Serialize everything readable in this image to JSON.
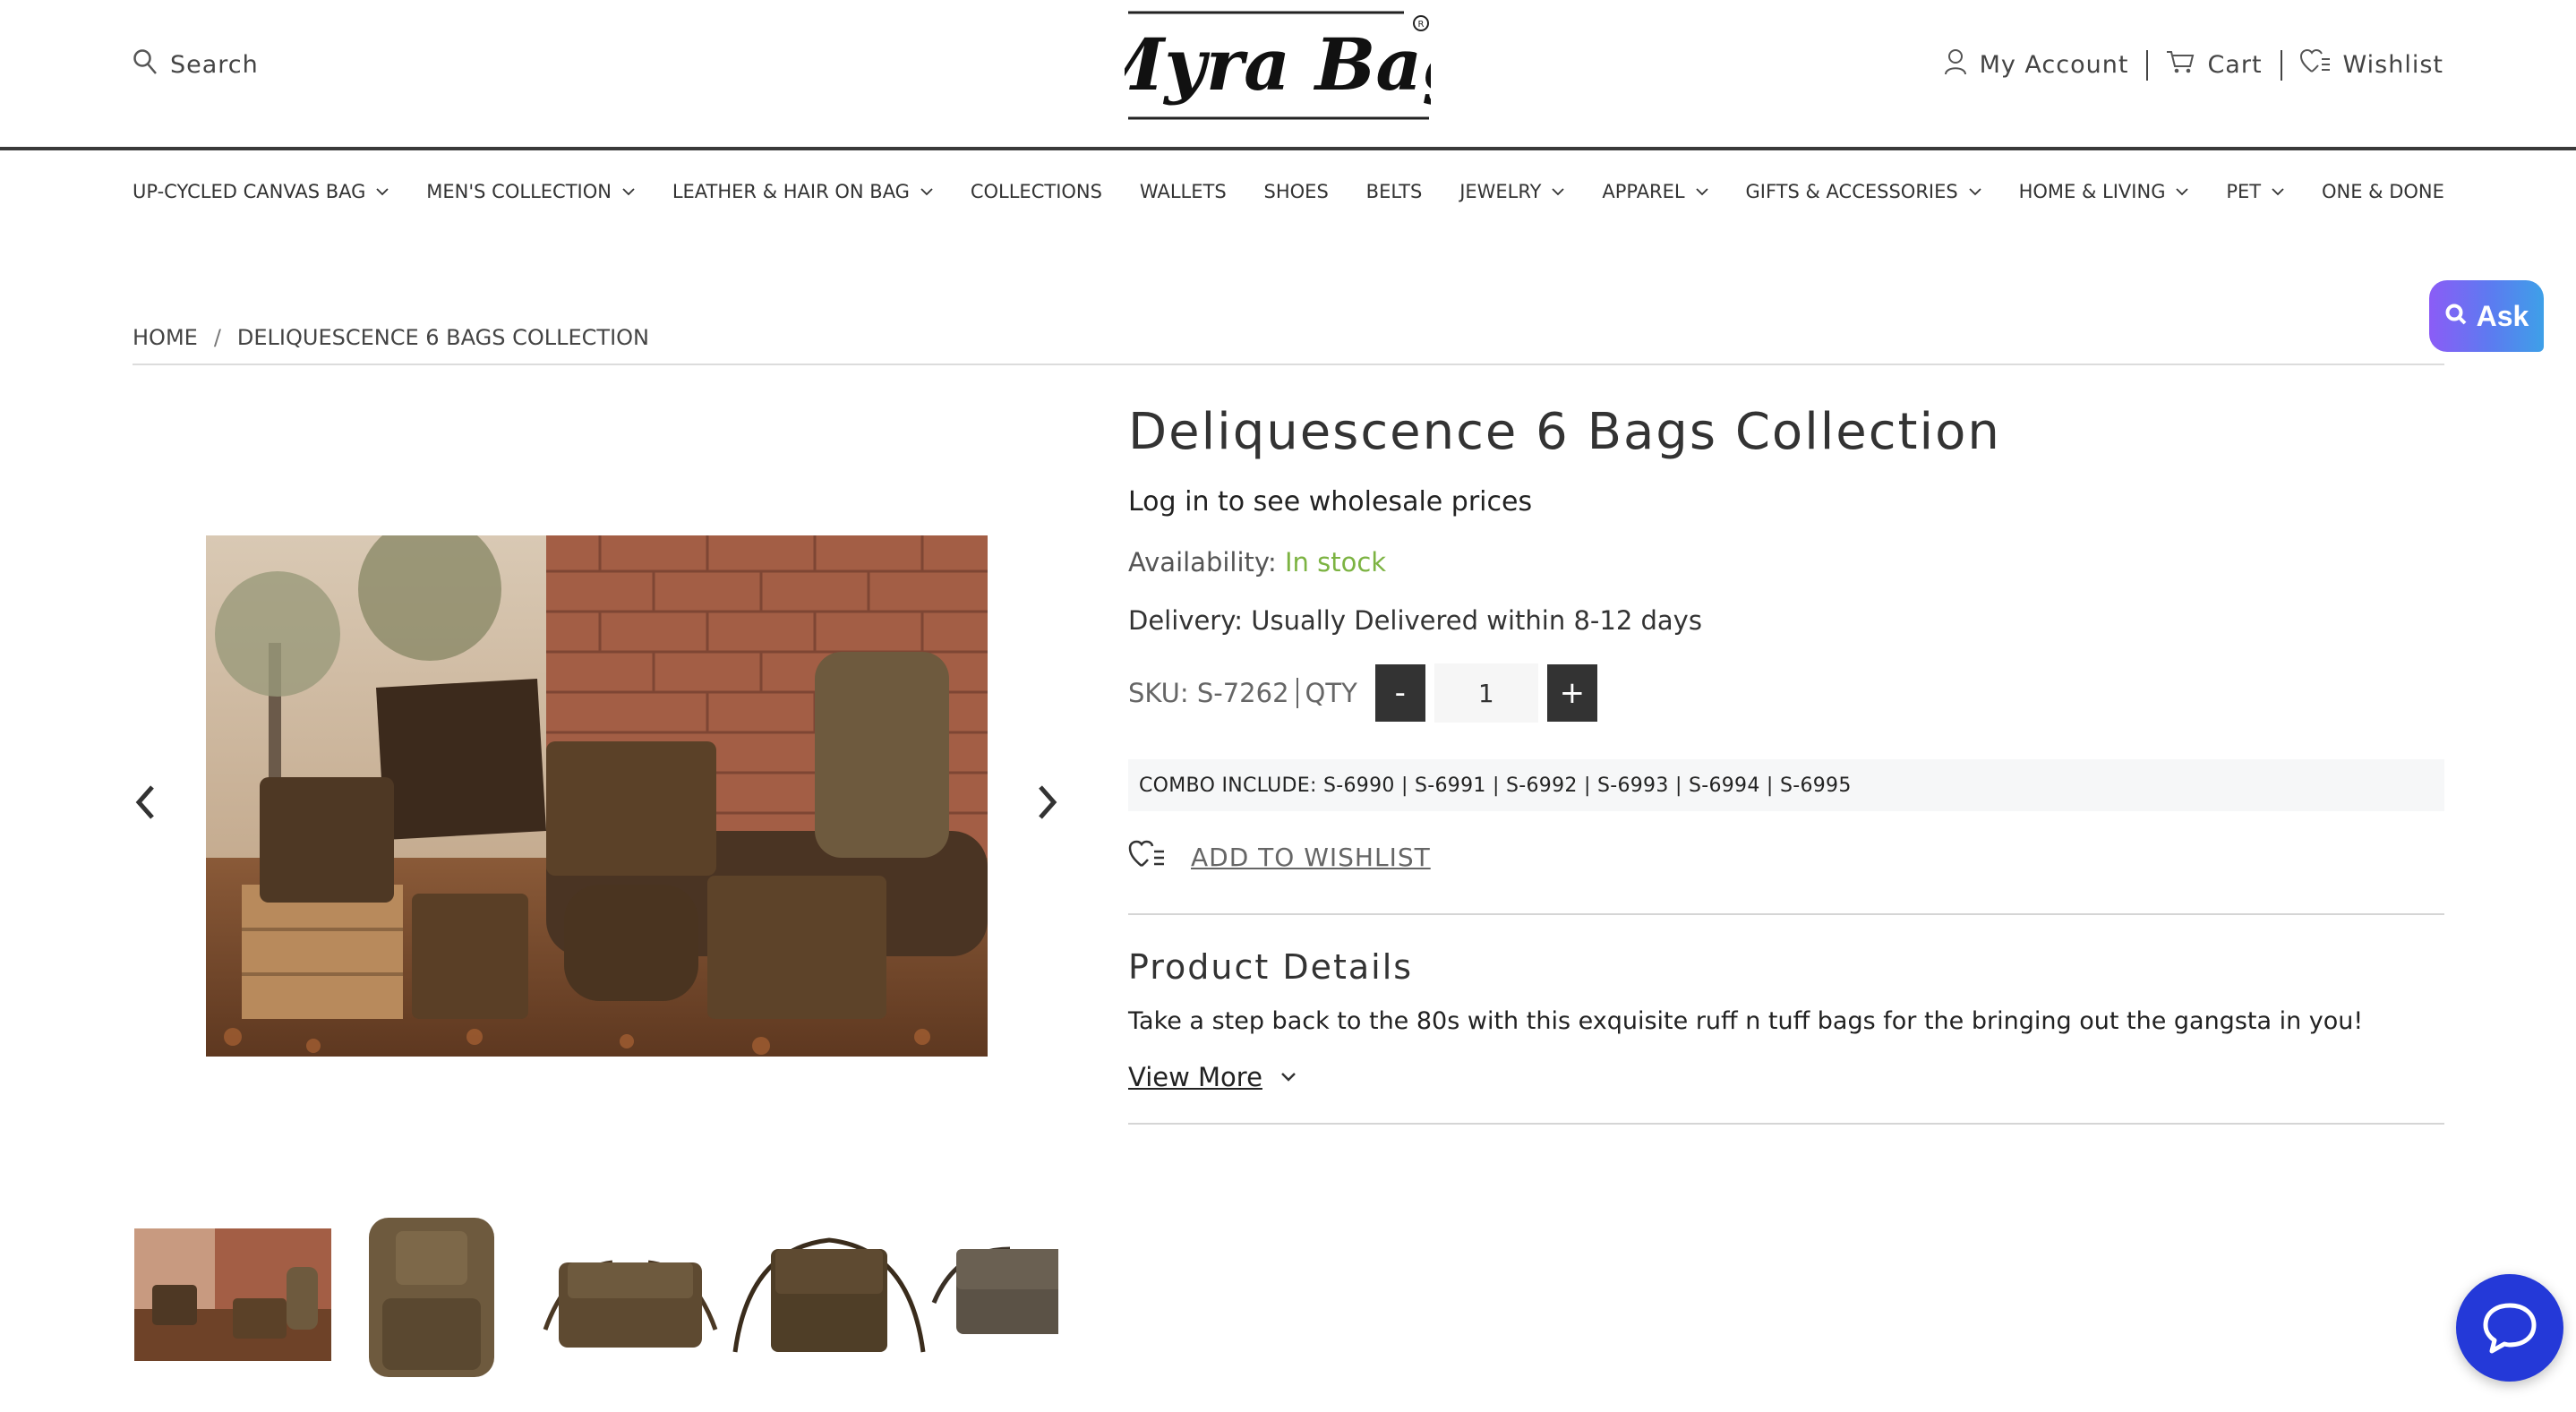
{
  "colors": {
    "accent_dark": "#333333",
    "in_stock": "#7cb342",
    "chat_button": "#2439d8",
    "ask_gradient": [
      "#8b5cf6",
      "#3ea0e8"
    ],
    "combo_background": "#f6f7f8"
  },
  "header": {
    "search_label": "Search",
    "logo_text": "Myra Bag",
    "account_label": "My Account",
    "cart_label": "Cart",
    "wishlist_label": "Wishlist"
  },
  "nav": {
    "items": [
      {
        "label": "UP-CYCLED CANVAS BAG",
        "dropdown": true
      },
      {
        "label": "MEN'S COLLECTION",
        "dropdown": true
      },
      {
        "label": "LEATHER & HAIR ON BAG",
        "dropdown": true
      },
      {
        "label": "COLLECTIONS",
        "dropdown": false
      },
      {
        "label": "WALLETS",
        "dropdown": false
      },
      {
        "label": "SHOES",
        "dropdown": false
      },
      {
        "label": "BELTS",
        "dropdown": false
      },
      {
        "label": "JEWELRY",
        "dropdown": true
      },
      {
        "label": "APPAREL",
        "dropdown": true
      },
      {
        "label": "GIFTS & ACCESSORIES",
        "dropdown": true
      },
      {
        "label": "HOME & LIVING",
        "dropdown": true
      },
      {
        "label": "PET",
        "dropdown": true
      },
      {
        "label": "ONE & DONE",
        "dropdown": false
      }
    ]
  },
  "ask_widget": {
    "label": "Ask"
  },
  "breadcrumb": {
    "home": "HOME",
    "separator": "/",
    "current": "DELIQUESCENCE 6 BAGS COLLECTION"
  },
  "product": {
    "title": "Deliquescence 6 Bags Collection",
    "wholesale_note": "Log in to see wholesale prices",
    "availability_label": "Availability:",
    "availability_value": "In stock",
    "delivery": "Delivery: Usually Delivered within 8-12 days",
    "sku": "SKU: S-7262",
    "qty_label": "QTY",
    "qty_minus": "-",
    "qty_value": "1",
    "qty_plus": "+",
    "combo": "COMBO INCLUDE: S-6990 | S-6991 | S-6992 | S-6993 | S-6994 | S-6995",
    "add_to_wishlist": "ADD TO WISHLIST",
    "details_title": "Product Details",
    "details_text": "Take a step back to the 80s with this exquisite ruff n tuff bags for the bringing out the gangsta in you!",
    "view_more": "View More"
  },
  "gallery": {
    "thumbnail_count": 5
  }
}
